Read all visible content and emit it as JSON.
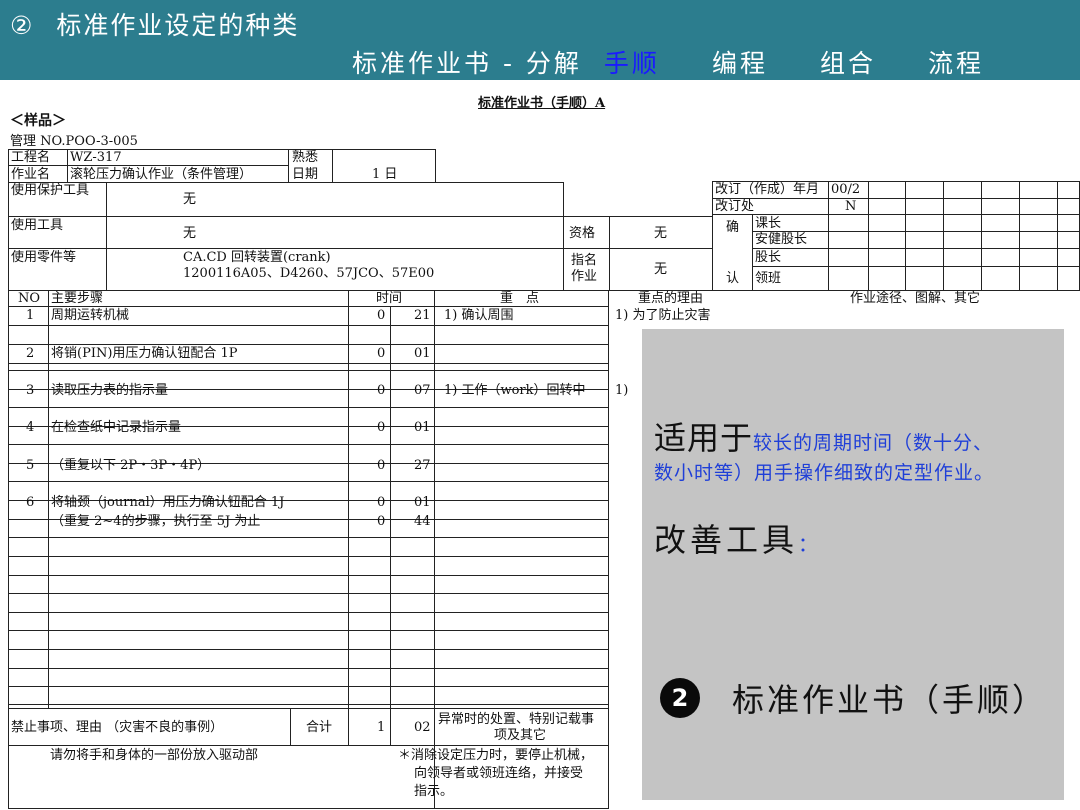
{
  "header": {
    "section_number": "②",
    "section_title": "标准作业设定的种类",
    "tabs": [
      {
        "label": "标准作业书 - 分解"
      },
      {
        "label": "手顺"
      },
      {
        "label": "编程"
      },
      {
        "label": "组合"
      },
      {
        "label": "流程"
      }
    ],
    "active_tab": "手顺"
  },
  "doc": {
    "title": "标准作业书（手顺）A",
    "sample_label": "＜样品＞",
    "management_no": "管理 NO.POO-3-005",
    "process_name_label": "工程名",
    "process_name_value": "WZ-317",
    "operation_name_label": "作业名",
    "operation_name_value": "滚轮压力确认作业（条件管理）",
    "proficiency_label": "熟悉",
    "days_label": "日期",
    "days_value": "1 日",
    "protective_tools_label": "使用保护工具",
    "protective_tools_value": "无",
    "tools_label": "使用工具",
    "tools_value": "无",
    "parts_label": "使用零件等",
    "parts_value_line1": "CA.CD 回转装置(crank)",
    "parts_value_line2": "1200116A05、D4260、57JCO、57E00",
    "qualification_label": "资格",
    "qualification_value": "无",
    "designated_work_label_1": "指名",
    "designated_work_label_2": "作业",
    "designated_work_value": "无",
    "revision_label": "改订（作成）年月",
    "revision_value": "00/2",
    "revision_place_label": "改订处",
    "revision_place_value": "N",
    "confirm_label_1": "确",
    "confirm_label_2": "认",
    "roles": [
      "课长",
      "安健股长",
      "股长",
      "领班"
    ],
    "columns": {
      "no": "NO",
      "main_steps": "主要步骤",
      "time": "时间",
      "key_points": "重　点",
      "reason": "重点的理由",
      "route": "作业途径、图解、其它"
    },
    "steps": [
      {
        "no": "1",
        "step": "周期运转机械",
        "min": "0",
        "sec": "21",
        "point": "1) 确认周围",
        "reason": "1) 为了防止灾害"
      },
      {
        "no": "2",
        "step": "将销(PIN)用压力确认钮配合 1P",
        "min": "0",
        "sec": "01",
        "point": "",
        "reason": ""
      },
      {
        "no": "3",
        "step": "读取压力表的指示量",
        "min": "0",
        "sec": "07",
        "point": "1) 工作（work）回转中",
        "reason": "1)"
      },
      {
        "no": "4",
        "step": "在检查纸中记录指示量",
        "min": "0",
        "sec": "01",
        "point": "",
        "reason": ""
      },
      {
        "no": "5",
        "step": "（重复以下 2P・3P・4P）",
        "min": "0",
        "sec": "27",
        "point": "",
        "reason": ""
      },
      {
        "no": "6",
        "step": "将轴颈（journal）用压力确认钮配合 1J",
        "min": "0",
        "sec": "01",
        "point": "",
        "reason": ""
      },
      {
        "no": "",
        "step": "（重复 2~4的步骤，执行至 5J 为止",
        "min": "0",
        "sec": "44",
        "point": "",
        "reason": ""
      }
    ],
    "footer": {
      "prohibited_label": "禁止事项、理由 （灾害不良的事例）",
      "total_label": "合计",
      "total_min": "1",
      "total_sec": "02",
      "abnormal_line1": "异常时的处置、特别记载事",
      "abnormal_line2": "项及其它",
      "prohibited_value": "请勿将手和身体的一部份放入驱动部",
      "note_line1": "＊消除设定压力时，要停止机械，",
      "note_line2": "向领导者或领班连络，并接受",
      "note_line3": "指示。"
    }
  },
  "overlay": {
    "applies_to": "适用于",
    "applies_desc_1": "较长的周期时间（数十分、",
    "applies_desc_2": "数小时等）用手操作细致的定型作业。",
    "tools_label": "改善工具",
    "tools_colon": "：",
    "item_number": "2",
    "item_label": "标准作业书（手顺）"
  },
  "colors": {
    "banner": "#2c7d8e",
    "active_tab": "#1a1aff",
    "overlay_bg": "#c4c4c4",
    "overlay_blue": "#1f3fd8"
  }
}
